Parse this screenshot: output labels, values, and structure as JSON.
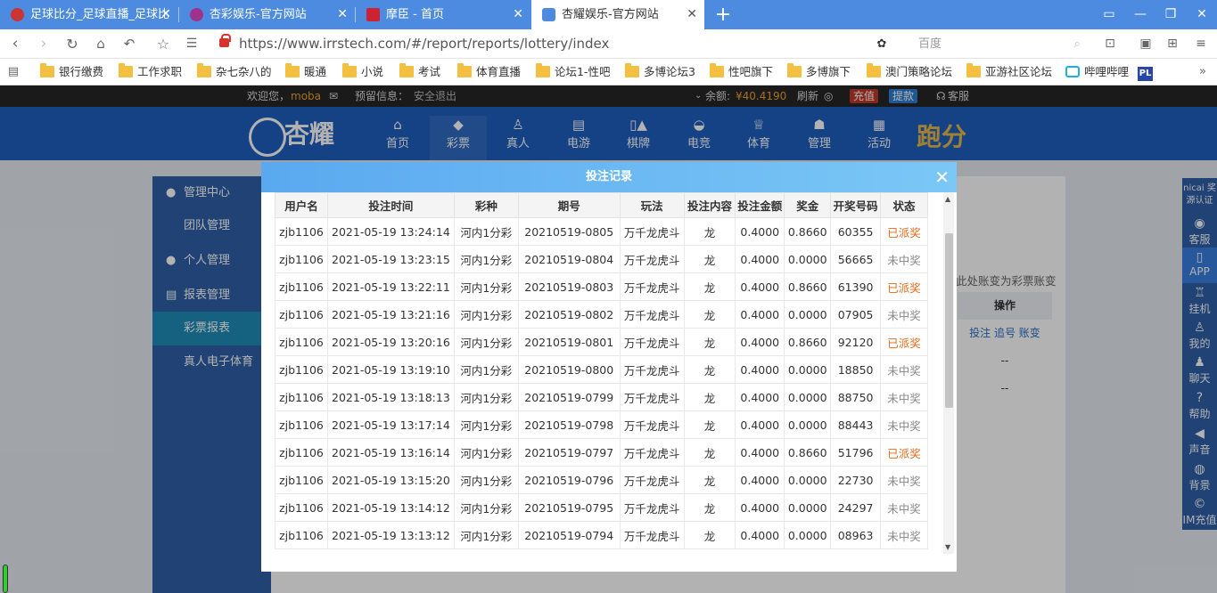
{
  "browser": {
    "tabs": [
      {
        "label": "足球比分_足球直播_足球比",
        "active": false
      },
      {
        "label": "杏彩娱乐-官方网站",
        "active": false
      },
      {
        "label": "摩臣 - 首页",
        "active": false
      },
      {
        "label": "杏耀娱乐-官方网站",
        "active": true
      }
    ],
    "url": "https://www.irrstech.com/#/report/reports/lottery/index",
    "search_placeholder": "百度",
    "bookmarks": [
      "银行缴费",
      "工作求职",
      "杂七杂八的",
      "暖通",
      "小说",
      "考试",
      "体育直播",
      "论坛1-性吧",
      "多博论坛3",
      "性吧旗下",
      "多博旗下",
      "澳门策略论坛",
      "亚游社区论坛",
      "哔哩哔哩"
    ]
  },
  "site": {
    "welcome": "欢迎您，",
    "username": "moba",
    "notice_label": "预留信息：",
    "logout": "安全退出",
    "balance_label": "余额:",
    "balance": "¥40.4190",
    "refresh": "刷新",
    "recharge": "充值",
    "withdraw": "提款",
    "service": "客服",
    "logo": "杏耀",
    "nav": [
      "首页",
      "彩票",
      "真人",
      "电游",
      "棋牌",
      "电竞",
      "体育",
      "管理",
      "活动"
    ],
    "sidebar": {
      "mgmt_center": "管理中心",
      "team_mgmt": "团队管理",
      "personal_mgmt": "个人管理",
      "report_mgmt": "报表管理",
      "lottery_report": "彩票报表",
      "live_sports": "真人电子体育"
    },
    "behind": {
      "note": "此处账变为彩票账变",
      "op_header": "操作",
      "op_links": "投注 追号 账变",
      "dash1": "--",
      "dash2": "--"
    },
    "rightbar": [
      "客服",
      "APP",
      "挂机",
      "我的",
      "聊天",
      "帮助",
      "声音",
      "背景",
      "IM充值"
    ],
    "rightbar_top": "nicai 奖源认证"
  },
  "modal": {
    "title": "投注记录",
    "headers": [
      "用户名",
      "投注时间",
      "彩种",
      "期号",
      "玩法",
      "投注内容",
      "投注金额",
      "奖金",
      "开奖号码",
      "状态"
    ],
    "rows": [
      [
        "zjb1106",
        "2021-05-19 13:24:14",
        "河内1分彩",
        "20210519-0805",
        "万千龙虎斗",
        "龙",
        "0.4000",
        "0.8660",
        "60355",
        "已派奖"
      ],
      [
        "zjb1106",
        "2021-05-19 13:23:15",
        "河内1分彩",
        "20210519-0804",
        "万千龙虎斗",
        "龙",
        "0.4000",
        "0.0000",
        "56665",
        "未中奖"
      ],
      [
        "zjb1106",
        "2021-05-19 13:22:11",
        "河内1分彩",
        "20210519-0803",
        "万千龙虎斗",
        "龙",
        "0.4000",
        "0.8660",
        "61390",
        "已派奖"
      ],
      [
        "zjb1106",
        "2021-05-19 13:21:16",
        "河内1分彩",
        "20210519-0802",
        "万千龙虎斗",
        "龙",
        "0.4000",
        "0.0000",
        "07905",
        "未中奖"
      ],
      [
        "zjb1106",
        "2021-05-19 13:20:16",
        "河内1分彩",
        "20210519-0801",
        "万千龙虎斗",
        "龙",
        "0.4000",
        "0.8660",
        "92120",
        "已派奖"
      ],
      [
        "zjb1106",
        "2021-05-19 13:19:10",
        "河内1分彩",
        "20210519-0800",
        "万千龙虎斗",
        "龙",
        "0.4000",
        "0.0000",
        "18850",
        "未中奖"
      ],
      [
        "zjb1106",
        "2021-05-19 13:18:13",
        "河内1分彩",
        "20210519-0799",
        "万千龙虎斗",
        "龙",
        "0.4000",
        "0.0000",
        "88750",
        "未中奖"
      ],
      [
        "zjb1106",
        "2021-05-19 13:17:14",
        "河内1分彩",
        "20210519-0798",
        "万千龙虎斗",
        "龙",
        "0.4000",
        "0.0000",
        "88443",
        "未中奖"
      ],
      [
        "zjb1106",
        "2021-05-19 13:16:14",
        "河内1分彩",
        "20210519-0797",
        "万千龙虎斗",
        "龙",
        "0.4000",
        "0.8660",
        "51796",
        "已派奖"
      ],
      [
        "zjb1106",
        "2021-05-19 13:15:20",
        "河内1分彩",
        "20210519-0796",
        "万千龙虎斗",
        "龙",
        "0.4000",
        "0.0000",
        "22730",
        "未中奖"
      ],
      [
        "zjb1106",
        "2021-05-19 13:14:12",
        "河内1分彩",
        "20210519-0795",
        "万千龙虎斗",
        "龙",
        "0.4000",
        "0.0000",
        "24297",
        "未中奖"
      ],
      [
        "zjb1106",
        "2021-05-19 13:13:12",
        "河内1分彩",
        "20210519-0794",
        "万千龙虎斗",
        "龙",
        "0.4000",
        "0.0000",
        "08963",
        "未中奖"
      ]
    ]
  },
  "colors": {
    "win": "#e06a1a",
    "lose": "#888888",
    "header_blue": "#1f5fbf"
  }
}
